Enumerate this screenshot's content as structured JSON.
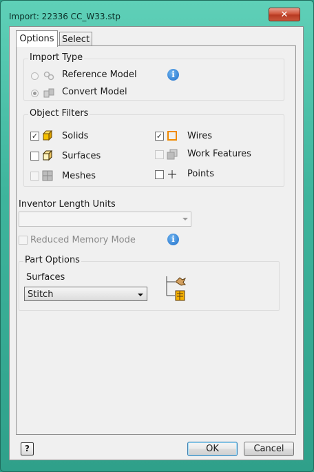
{
  "window": {
    "title": "Import:  22336 CC_W33.stp",
    "close_glyph": "✕"
  },
  "tabs": [
    {
      "label": "Options",
      "active": true
    },
    {
      "label": "Select",
      "active": false
    }
  ],
  "import_type": {
    "heading": "Import Type",
    "reference_model": "Reference Model",
    "convert_model": "Convert Model",
    "selected": "Convert Model",
    "info_glyph": "i"
  },
  "object_filters": {
    "heading": "Object Filters",
    "solids": {
      "label": "Solids",
      "checked": true
    },
    "surfaces": {
      "label": "Surfaces",
      "checked": false
    },
    "meshes": {
      "label": "Meshes",
      "checked": false
    },
    "wires": {
      "label": "Wires",
      "checked": true
    },
    "work_features": {
      "label": "Work Features",
      "checked": false
    },
    "points": {
      "label": "Points",
      "checked": false
    },
    "check_glyph": "✓"
  },
  "length_units": {
    "label": "Inventor Length Units",
    "value": ""
  },
  "reduced_memory": {
    "label": "Reduced Memory Mode",
    "checked": false
  },
  "part_options": {
    "heading": "Part Options",
    "surfaces_label": "Surfaces",
    "surfaces_value": "Stitch"
  },
  "footer": {
    "help_glyph": "?",
    "ok": "OK",
    "cancel": "Cancel"
  },
  "colors": {
    "accent": "#1f6fc9",
    "window_frame": "#3fb59d",
    "close": "#c8573c"
  }
}
